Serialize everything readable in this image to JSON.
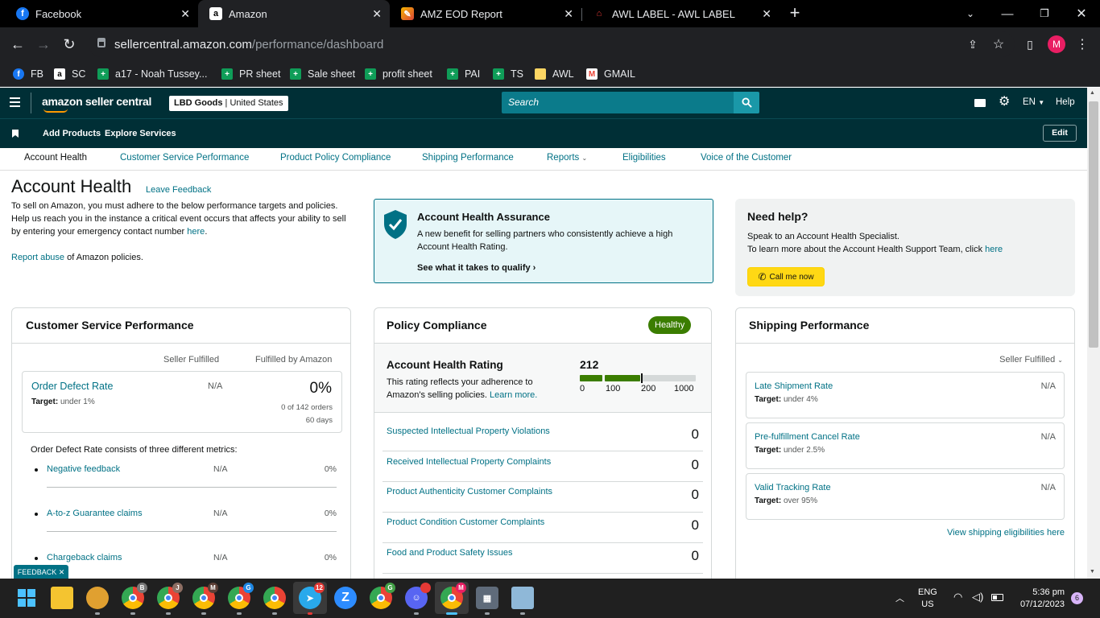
{
  "browser": {
    "tabs": [
      {
        "title": "Facebook",
        "icon": "facebook-icon"
      },
      {
        "title": "Amazon",
        "icon": "amazon-icon"
      },
      {
        "title": "AMZ EOD Report",
        "icon": "report-icon"
      },
      {
        "title": "AWL LABEL - AWL LABEL",
        "icon": "awl-icon"
      }
    ],
    "url_host": "sellercentral.amazon.com",
    "url_path": "/performance/dashboard",
    "profile_initial": "M",
    "bookmarks": [
      {
        "label": "FB",
        "icon": "facebook-icon"
      },
      {
        "label": "SC",
        "icon": "amazon-icon"
      },
      {
        "label": "a17 - Noah Tussey...",
        "icon": "sheets-icon"
      },
      {
        "label": "PR sheet",
        "icon": "sheets-icon"
      },
      {
        "label": "Sale sheet",
        "icon": "sheets-icon"
      },
      {
        "label": "profit sheet",
        "icon": "sheets-icon"
      },
      {
        "label": "PAI",
        "icon": "sheets-icon"
      },
      {
        "label": "TS",
        "icon": "sheets-icon"
      },
      {
        "label": "AWL",
        "icon": "folder-icon"
      },
      {
        "label": "GMAIL",
        "icon": "gmail-icon"
      }
    ]
  },
  "sc": {
    "logo": "amazon seller central",
    "store": "LBD Goods",
    "marketplace": "United States",
    "search_placeholder": "Search",
    "language": "EN",
    "help": "Help",
    "nav": {
      "add_products": "Add Products",
      "explore_services": "Explore Services",
      "edit": "Edit"
    },
    "subtabs": [
      "Account Health",
      "Customer Service Performance",
      "Product Policy Compliance",
      "Shipping Performance",
      "Reports",
      "Eligibilities",
      "Voice of the Customer"
    ]
  },
  "intro": {
    "title": "Account Health",
    "feedback_link": "Leave Feedback",
    "p1": "To sell on Amazon, you must adhere to the below performance targets and policies.",
    "p2_a": "Help us reach you in the instance a critical event occurs that affects your ability to sell by entering your emergency contact number ",
    "p2_link": "here",
    "p2_b": ".",
    "abuse_link": "Report abuse",
    "abuse_text": " of Amazon policies."
  },
  "assurance": {
    "title": "Account Health Assurance",
    "desc": "A new benefit for selling partners who consistently achieve a high Account Health Rating.",
    "link": "See what it takes to qualify"
  },
  "help": {
    "title": "Need help?",
    "line1": "Speak to an Account Health Specialist.",
    "line2": "To learn more about the Account Health Support Team, click ",
    "line2_link": "here",
    "call_button": "Call me now"
  },
  "csp": {
    "title": "Customer Service Performance",
    "col_seller": "Seller Fulfilled",
    "col_fba": "Fulfilled by Amazon",
    "odr_label": "Order Defect Rate",
    "odr_target_label": "Target:",
    "odr_target": "under 1%",
    "odr_seller": "N/A",
    "odr_fba": "0%",
    "odr_orders": "0 of 142 orders",
    "odr_days": "60 days",
    "consists": "Order Defect Rate consists of three different metrics:",
    "metrics": [
      {
        "label": "Negative feedback",
        "seller": "N/A",
        "fba": "0%"
      },
      {
        "label": "A-to-z Guarantee claims",
        "seller": "N/A",
        "fba": "0%"
      },
      {
        "label": "Chargeback claims",
        "seller": "N/A",
        "fba": "0%"
      }
    ]
  },
  "policy": {
    "title": "Policy Compliance",
    "badge": "Healthy",
    "ahr_title": "Account Health Rating",
    "ahr_desc": "This rating reflects your adherence to Amazon's selling policies. ",
    "ahr_link": "Learn more.",
    "ahr_value": "212",
    "ahr_level": 0.212,
    "scale": [
      "0",
      "100",
      "200",
      "1000"
    ],
    "items": [
      {
        "label": "Suspected Intellectual Property Violations",
        "count": "0"
      },
      {
        "label": "Received Intellectual Property Complaints",
        "count": "0"
      },
      {
        "label": "Product Authenticity Customer Complaints",
        "count": "0"
      },
      {
        "label": "Product Condition Customer Complaints",
        "count": "0"
      },
      {
        "label": "Food and Product Safety Issues",
        "count": "0"
      }
    ]
  },
  "shipping": {
    "title": "Shipping Performance",
    "filter": "Seller Fulfilled",
    "metrics": [
      {
        "label": "Late Shipment Rate",
        "target": "under 4%",
        "value": "N/A"
      },
      {
        "label": "Pre-fulfillment Cancel Rate",
        "target": "under 2.5%",
        "value": "N/A"
      },
      {
        "label": "Valid Tracking Rate",
        "target": "over 95%",
        "value": "N/A"
      }
    ],
    "target_label": "Target:",
    "elig_link": "View shipping eligibilities here"
  },
  "feedback_tab": "FEEDBACK",
  "taskbar": {
    "lang": "ENG",
    "region": "US",
    "time": "5:36 pm",
    "date": "07/12/2023",
    "notif": "6",
    "telegram_badge": "12"
  },
  "colors": {
    "sc_dark": "#002f36",
    "search": "#0b7b8b",
    "link": "#007185",
    "healthy": "#3b7d00",
    "assurance_bg": "#e6f6f8",
    "call_btn": "#ffd814"
  }
}
